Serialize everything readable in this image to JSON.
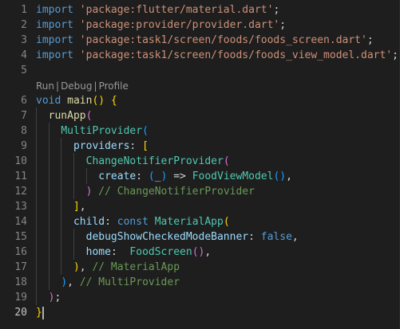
{
  "editor": {
    "codelens": {
      "run": "Run",
      "debug": "Debug",
      "profile": "Profile",
      "sep": "|"
    },
    "lines": [
      {
        "num": "1",
        "tokens": [
          [
            "k",
            "import"
          ],
          [
            "o",
            " "
          ],
          [
            "s",
            "'package:flutter/material.dart'"
          ],
          [
            "o",
            ";"
          ]
        ]
      },
      {
        "num": "2",
        "tokens": [
          [
            "k",
            "import"
          ],
          [
            "o",
            " "
          ],
          [
            "s",
            "'package:provider/provider.dart'"
          ],
          [
            "o",
            ";"
          ]
        ]
      },
      {
        "num": "3",
        "tokens": [
          [
            "k",
            "import"
          ],
          [
            "o",
            " "
          ],
          [
            "s",
            "'package:task1/screen/foods/foods_screen.dart'"
          ],
          [
            "o",
            ";"
          ]
        ]
      },
      {
        "num": "4",
        "tokens": [
          [
            "k",
            "import"
          ],
          [
            "o",
            " "
          ],
          [
            "s",
            "'package:task1/screen/foods/foods_view_model.dart'"
          ],
          [
            "o",
            ";"
          ]
        ]
      },
      {
        "num": "5",
        "tokens": []
      },
      {
        "num": "6",
        "tokens": [
          [
            "k",
            "void"
          ],
          [
            "o",
            " "
          ],
          [
            "f",
            "main"
          ],
          [
            "y",
            "()"
          ],
          [
            "o",
            " "
          ],
          [
            "y",
            "{"
          ]
        ]
      },
      {
        "num": "7",
        "tokens": [
          [
            "o",
            "  "
          ],
          [
            "f",
            "runApp"
          ],
          [
            "pink",
            "("
          ]
        ]
      },
      {
        "num": "8",
        "tokens": [
          [
            "o",
            "    "
          ],
          [
            "c",
            "MultiProvider"
          ],
          [
            "bl",
            "("
          ]
        ]
      },
      {
        "num": "9",
        "tokens": [
          [
            "o",
            "      "
          ],
          [
            "p",
            "providers"
          ],
          [
            "o",
            ": "
          ],
          [
            "y",
            "["
          ]
        ]
      },
      {
        "num": "10",
        "tokens": [
          [
            "o",
            "        "
          ],
          [
            "c",
            "ChangeNotifierProvider"
          ],
          [
            "pink",
            "("
          ]
        ]
      },
      {
        "num": "11",
        "tokens": [
          [
            "o",
            "          "
          ],
          [
            "p",
            "create"
          ],
          [
            "o",
            ": "
          ],
          [
            "bl",
            "("
          ],
          [
            "p",
            "_"
          ],
          [
            "bl",
            ")"
          ],
          [
            "o",
            " => "
          ],
          [
            "c",
            "FoodViewModel"
          ],
          [
            "bl",
            "()"
          ],
          [
            "o",
            ","
          ]
        ]
      },
      {
        "num": "12",
        "tokens": [
          [
            "o",
            "        "
          ],
          [
            "pink",
            ")"
          ],
          [
            "o",
            " "
          ],
          [
            "cm",
            "// ChangeNotifierProvider"
          ]
        ]
      },
      {
        "num": "13",
        "tokens": [
          [
            "o",
            "      "
          ],
          [
            "y",
            "]"
          ],
          [
            "o",
            ","
          ]
        ]
      },
      {
        "num": "14",
        "tokens": [
          [
            "o",
            "      "
          ],
          [
            "p",
            "child"
          ],
          [
            "o",
            ": "
          ],
          [
            "k",
            "const"
          ],
          [
            "o",
            " "
          ],
          [
            "c",
            "MaterialApp"
          ],
          [
            "y",
            "("
          ]
        ]
      },
      {
        "num": "15",
        "tokens": [
          [
            "o",
            "        "
          ],
          [
            "p",
            "debugShowCheckedModeBanner"
          ],
          [
            "o",
            ": "
          ],
          [
            "k",
            "false"
          ],
          [
            "o",
            ","
          ]
        ]
      },
      {
        "num": "16",
        "tokens": [
          [
            "o",
            "        "
          ],
          [
            "p",
            "home"
          ],
          [
            "o",
            ":  "
          ],
          [
            "c",
            "FoodScreen"
          ],
          [
            "pink",
            "()"
          ],
          [
            "o",
            ","
          ]
        ]
      },
      {
        "num": "17",
        "tokens": [
          [
            "o",
            "      "
          ],
          [
            "y",
            ")"
          ],
          [
            "o",
            ", "
          ],
          [
            "cm",
            "// MaterialApp"
          ]
        ]
      },
      {
        "num": "18",
        "tokens": [
          [
            "o",
            "    "
          ],
          [
            "bl",
            ")"
          ],
          [
            "o",
            ", "
          ],
          [
            "cm",
            "// MultiProvider"
          ]
        ]
      },
      {
        "num": "19",
        "tokens": [
          [
            "o",
            "  "
          ],
          [
            "pink",
            ")"
          ],
          [
            "o",
            ";"
          ]
        ]
      },
      {
        "num": "20",
        "tokens": [
          [
            "y",
            "}"
          ]
        ]
      }
    ],
    "active_line": "20"
  }
}
